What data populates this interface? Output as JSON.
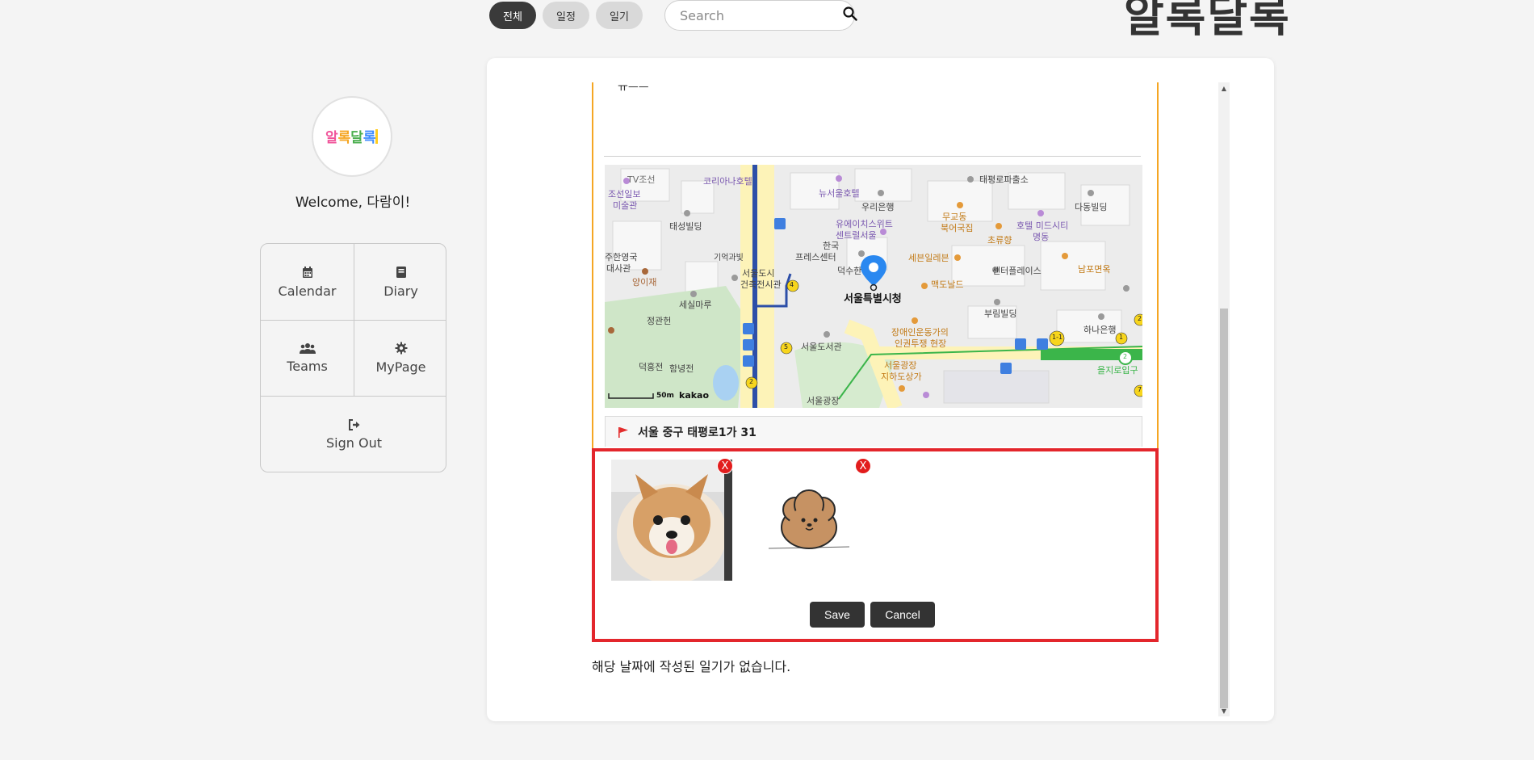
{
  "header": {
    "tabs": [
      {
        "label": "전체",
        "active": true
      },
      {
        "label": "일정",
        "active": false
      },
      {
        "label": "일기",
        "active": false
      }
    ],
    "search": {
      "placeholder": "Search"
    },
    "brand": "알록달록"
  },
  "sidebar": {
    "avatar_text": "알록달록",
    "welcome": "Welcome, 다람이!",
    "menu": [
      {
        "label": "Calendar",
        "icon": "calendar-icon"
      },
      {
        "label": "Diary",
        "icon": "book-icon"
      },
      {
        "label": "Teams",
        "icon": "users-icon"
      },
      {
        "label": "MyPage",
        "icon": "gear-icon"
      },
      {
        "label": "Sign Out",
        "icon": "sign-out-icon"
      }
    ]
  },
  "entry": {
    "text_fragment": "ㅠㅡㅡ",
    "map": {
      "labels": {
        "tv": "TV조선",
        "koreana": "코리아나호텔",
        "newseoul": "뉴서울호텔",
        "woori": "우리은행",
        "taepyeongro": "태평로파출소",
        "dadong": "다동빌딩",
        "chosun1": "조선일보",
        "chosun2": "미술관",
        "taeseong": "태성빌딩",
        "uace1": "유에이치스위트",
        "uace2": "센트럴서울",
        "mugyo1": "무교동",
        "mugyo2": "북어국집",
        "chorhyang": "초류향",
        "midcity1": "호텔 미드시티",
        "midcity2": "명동",
        "uk1": "주한영국",
        "uk2": "대사관",
        "memory": "기억과빛",
        "archives1": "서울도시",
        "archives2": "건축전시관",
        "press1": "한국",
        "press2": "프레스센터",
        "deoksu": "덕수한",
        "seven": "세븐일레븐",
        "centerplace": "센터플레이스",
        "nampo": "남포면옥",
        "yangi": "양이재",
        "seosil": "세실마루",
        "hall": "서울특별시청",
        "mcd": "맥도날드",
        "burim": "부림빌딩",
        "hana": "하나은행",
        "jeonggwan": "정관헌",
        "disability1": "장애인운동가의",
        "disability2": "인권투쟁 현장",
        "library": "서울도서관",
        "deokhong": "덕홍전",
        "hamnyeong": "함녕전",
        "underground1": "서울광장",
        "underground2": "지하도상가",
        "plaza": "서울광장",
        "euljiro": "을지로입구",
        "scale": "50m",
        "logo": "kakao"
      },
      "route_badges": [
        "4",
        "5",
        "2",
        "1",
        "2",
        "1-1",
        "2",
        "7"
      ]
    },
    "address": "서울 중구 태평로1가 31"
  },
  "photos": {
    "items": [
      {
        "alt": "pomeranian-photo"
      },
      {
        "alt": "puppy-drawing"
      }
    ],
    "remove_label": "X",
    "save_label": "Save",
    "cancel_label": "Cancel"
  },
  "message": "해당 날짜에 작성된 일기가 없습니다.",
  "colors": {
    "accent_border": "#f5a623",
    "highlight_border": "#e3262c",
    "button_dark": "#333333",
    "remove_red": "#e21d1d"
  }
}
